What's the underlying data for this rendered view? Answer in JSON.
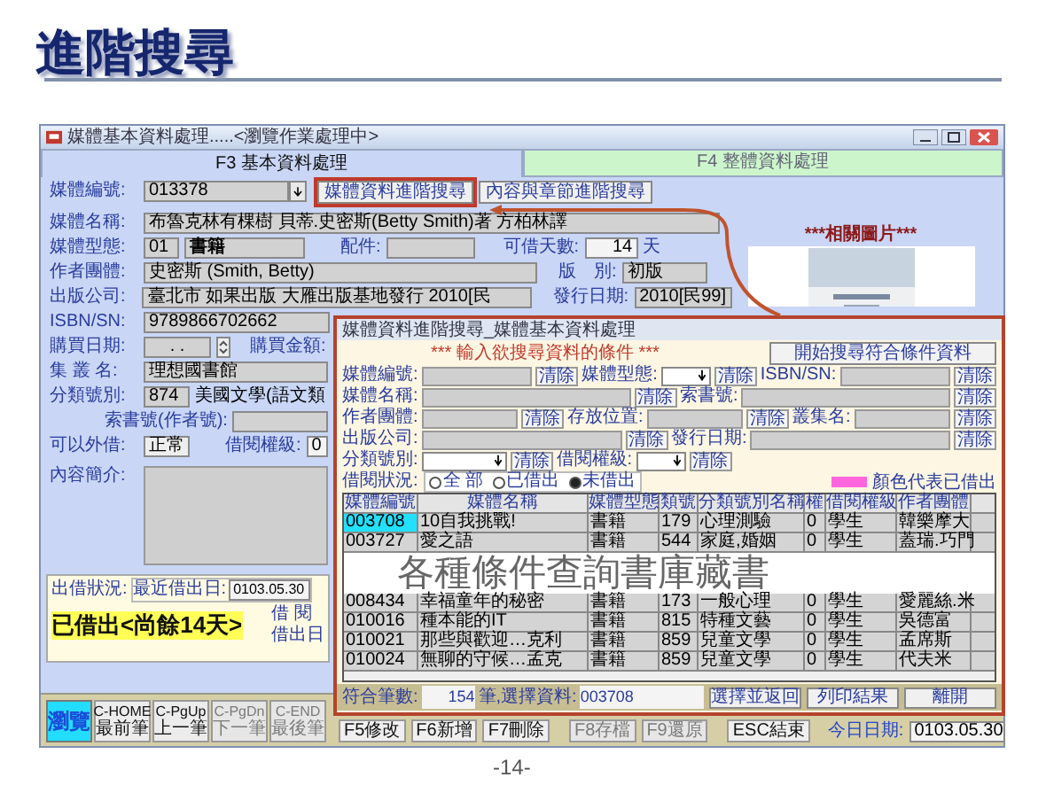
{
  "slide": {
    "title": "進階搜尋",
    "page_number": "-14-"
  },
  "main_window": {
    "title": "媒體基本資料處理.....<瀏覽作業處理中>",
    "tabs": [
      {
        "label": "F3 基本資料處理",
        "selected": true
      },
      {
        "label": "F4 整體資料處理",
        "selected": false
      }
    ],
    "media_id": {
      "label": "媒體編號:",
      "value": "013378"
    },
    "search_buttons": [
      {
        "label": "媒體資料進階搜尋",
        "highlighted": true
      },
      {
        "label": "內容與章節進階搜尋",
        "highlighted": false
      }
    ],
    "media_name": {
      "label": "媒體名稱:",
      "value": "布魯克林有棵樹 貝蒂.史密斯(Betty Smith)著 方柏林譯"
    },
    "media_type": {
      "label": "媒體型態:",
      "code": "01",
      "value": "書籍"
    },
    "accessory": {
      "label": "配件:"
    },
    "loan_days": {
      "label": "可借天數:",
      "value": "14",
      "unit": "天"
    },
    "author": {
      "label": "作者團體:",
      "value": "史密斯 (Smith, Betty)"
    },
    "edition": {
      "label": "版　別:",
      "value": "初版"
    },
    "publisher": {
      "label": "出版公司:",
      "value": "臺北市 如果出版 大雁出版基地發行 2010[民"
    },
    "publish_date": {
      "label": "發行日期:",
      "value": "2010[民99]"
    },
    "isbn": {
      "label": "ISBN/SN:",
      "value": "9789866702662"
    },
    "related_image": {
      "title": "***相關圖片***"
    },
    "purchase_date": {
      "label": "購買日期:",
      "value": ". ."
    },
    "purchase_amount": {
      "label": "購買金額:"
    },
    "series": {
      "label": "集 叢 名:",
      "value": "理想國書館"
    },
    "classification": {
      "label": "分類號別:",
      "code": "874",
      "name": "美國文學(語文類"
    },
    "call_number": {
      "label": "索書號(作者號):"
    },
    "lendable": {
      "label": "可以外借:",
      "value": "正常"
    },
    "loan_level": {
      "label": "借閱權級:",
      "value": "0"
    },
    "summary": {
      "label": "內容簡介:"
    },
    "loan_status": {
      "label": "出借狀況:",
      "last_loan_label": "最近借出日:",
      "last_loan_date": "0103.05.30",
      "status": "已借出<尚餘14天>",
      "borrower_label": "借 閱",
      "loan_date_label": "借出日"
    },
    "browse_button": {
      "label": "瀏覽"
    },
    "nav_buttons": [
      {
        "key": "C-HOME",
        "label": "最前筆",
        "disabled": false
      },
      {
        "key": "C-PgUp",
        "label": "上一筆",
        "disabled": false
      },
      {
        "key": "C-PgDn",
        "label": "下一筆",
        "disabled": true
      },
      {
        "key": "C-END",
        "label": "最後筆",
        "disabled": true
      }
    ],
    "action_buttons": [
      {
        "label": "F5修改",
        "disabled": false
      },
      {
        "label": "F6新增",
        "disabled": false
      },
      {
        "label": "F7刪除",
        "disabled": false
      },
      {
        "label": "F8存檔",
        "disabled": true
      },
      {
        "label": "F9還原",
        "disabled": true
      },
      {
        "label": "ESC結束",
        "disabled": false
      }
    ],
    "today": {
      "label": "今日日期:",
      "value": "0103.05.30"
    }
  },
  "search_dialog": {
    "title": "媒體資料進階搜尋_媒體基本資料處理",
    "heading": "*** 輸入欲搜尋資料的條件 ***",
    "start_button": "開始搜尋符合條件資料",
    "criteria_rows": [
      [
        {
          "label": "媒體編號:",
          "kind": "text",
          "clear": "清除"
        },
        {
          "label": "媒體型態:",
          "kind": "select",
          "clear": "清除"
        },
        {
          "label": "ISBN/SN:",
          "kind": "text",
          "clear": "清除"
        }
      ],
      [
        {
          "label": "媒體名稱:",
          "kind": "text",
          "clear": "清除"
        },
        {
          "label": "索書號:",
          "kind": "text",
          "clear": "清除"
        }
      ],
      [
        {
          "label": "作者團體:",
          "kind": "text",
          "clear": "清除"
        },
        {
          "label": "存放位置:",
          "kind": "text",
          "clear": "清除"
        },
        {
          "label": "叢集名:",
          "kind": "text",
          "clear": "清除"
        }
      ],
      [
        {
          "label": "出版公司:",
          "kind": "text",
          "clear": "清除"
        },
        {
          "label": "發行日期:",
          "kind": "text",
          "clear": "清除"
        }
      ],
      [
        {
          "label": "分類號別:",
          "kind": "select",
          "clear": "清除"
        },
        {
          "label": "借閱權級:",
          "kind": "select",
          "clear": "清除"
        }
      ]
    ],
    "loan_filter": {
      "label": "借閱狀況:",
      "options": [
        {
          "label": "全 部",
          "selected": false
        },
        {
          "label": "已借出",
          "selected": false
        },
        {
          "label": "未借出",
          "selected": true
        }
      ]
    },
    "legend": {
      "label": "顏色代表已借出"
    },
    "table": {
      "columns": [
        "媒體編號",
        "媒體名稱",
        "媒體型態",
        "類號",
        "分類號別名稱",
        "權",
        "借閱權級",
        "作者團體"
      ],
      "rows_before": [
        {
          "cells": [
            "003708",
            "10自我挑戰!",
            "書籍",
            "179",
            "心理測驗",
            "0",
            "學生",
            "韓樂摩大"
          ],
          "selected": true
        },
        {
          "cells": [
            "003727",
            "愛之語",
            "書籍",
            "544",
            "家庭,婚姻",
            "0",
            "學生",
            "蓋瑞.巧門"
          ],
          "selected": false
        }
      ],
      "rows_after": [
        {
          "cells": [
            "008434",
            "幸福童年的秘密",
            "書籍",
            "173",
            "一般心理",
            "0",
            "學生",
            "愛麗絲.米"
          ],
          "selected": false
        },
        {
          "cells": [
            "010016",
            "種本能的IT",
            "書籍",
            "815",
            "特種文藝",
            "0",
            "學生",
            "吳德富"
          ],
          "selected": false
        },
        {
          "cells": [
            "010021",
            "那些與歡迎…克利",
            "書籍",
            "859",
            "兒童文學",
            "0",
            "學生",
            "孟席斯"
          ],
          "selected": false
        },
        {
          "cells": [
            "010024",
            "無聊的守候…孟克",
            "書籍",
            "859",
            "兒童文學",
            "0",
            "學生",
            "代夫米"
          ],
          "selected": false
        }
      ]
    },
    "caption": "各種條件查詢書庫藏書",
    "footer": {
      "count_label": "符合筆數:",
      "count": "154",
      "selection_label": "筆,選擇資料:",
      "selection": "003708",
      "buttons": [
        "選擇並返回",
        "列印結果",
        "離開"
      ]
    }
  }
}
